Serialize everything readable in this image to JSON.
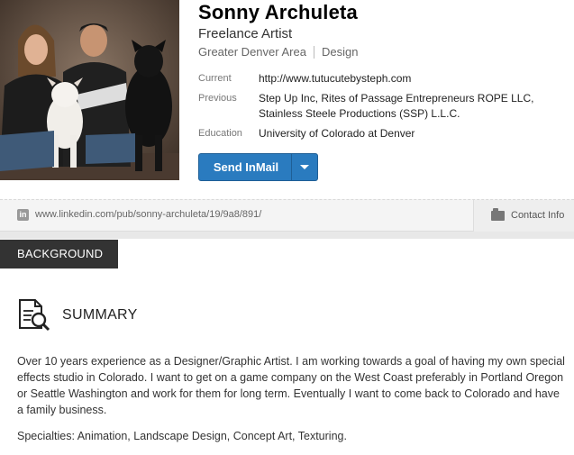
{
  "profile": {
    "name": "Sonny Archuleta",
    "headline": "Freelance Artist",
    "location": "Greater Denver Area",
    "industry": "Design"
  },
  "info": {
    "current_label": "Current",
    "current_value": "http://www.tutucutebysteph.com",
    "previous_label": "Previous",
    "previous_value": "Step Up Inc, Rites of Passage Entrepreneurs ROPE LLC, Stainless Steele Productions (SSP) L.L.C.",
    "education_label": "Education",
    "education_value": "University of Colorado at Denver"
  },
  "actions": {
    "send_inmail": "Send InMail"
  },
  "urlbar": {
    "icon": "linkedin-icon",
    "url": "www.linkedin.com/pub/sonny-archuleta/19/9a8/891/",
    "contact_label": "Contact Info",
    "contact_icon": "briefcase-icon"
  },
  "background": {
    "tab_label": "BACKGROUND",
    "summary_title": "SUMMARY",
    "summary_icon": "document-search-icon",
    "summary_text": "Over 10 years experience as a Designer/Graphic Artist. I am working towards a goal of having my own special effects studio in Colorado. I want to get on a game company on the West Coast preferably in Portland Oregon or Seattle Washington and work for them for long term. Eventually I want to come back to Colorado and have a family business.",
    "specialties": "Specialties: Animation, Landscape Design, Concept Art, Texturing."
  },
  "colors": {
    "accent": "#2a7bbf",
    "tab_bg": "#333333"
  }
}
